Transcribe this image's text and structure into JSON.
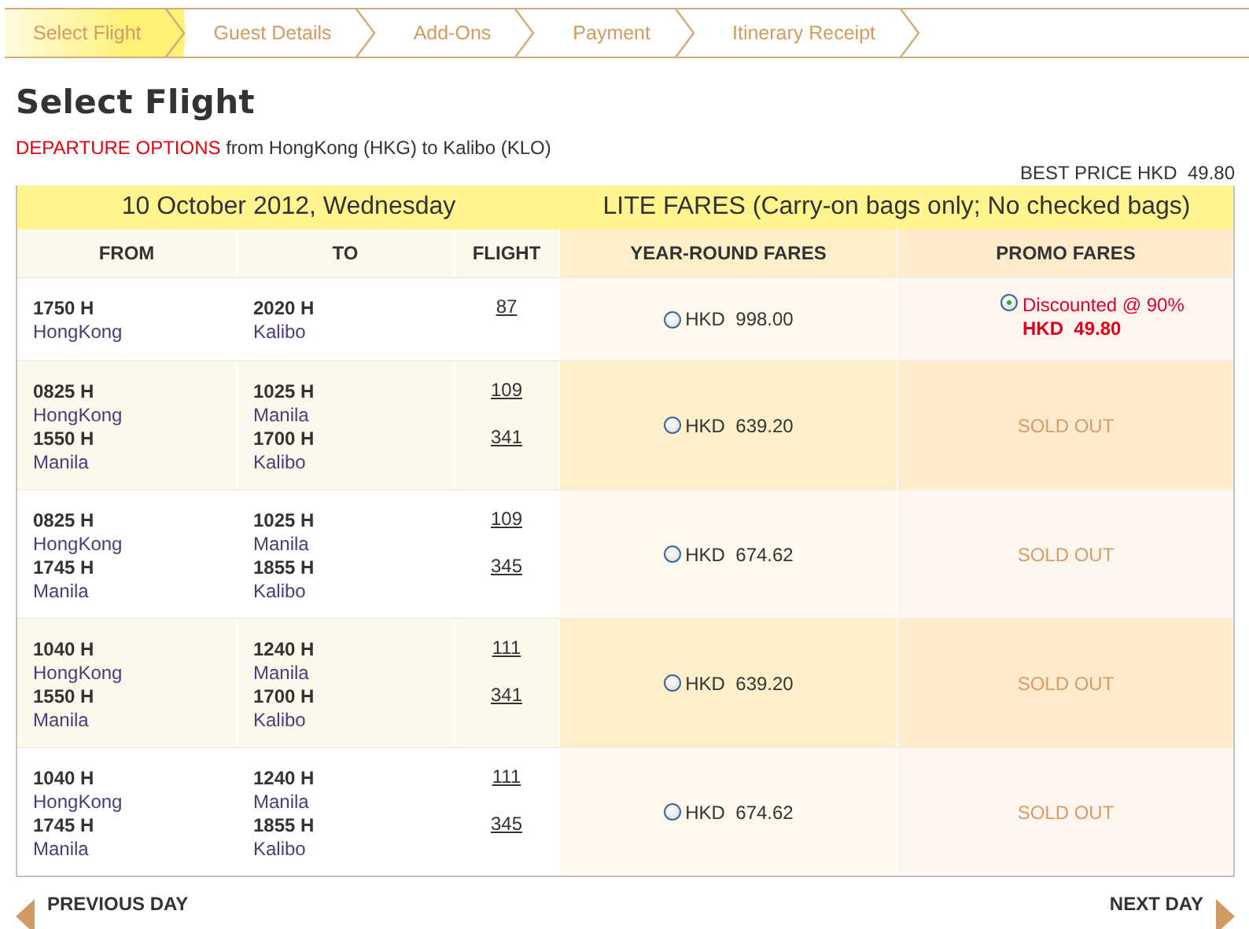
{
  "steps": [
    {
      "label": "Select Flight",
      "selected": true
    },
    {
      "label": "Guest Details",
      "selected": false
    },
    {
      "label": "Add-Ons",
      "selected": false
    },
    {
      "label": "Payment",
      "selected": false
    },
    {
      "label": "Itinerary Receipt",
      "selected": false
    }
  ],
  "title": "Select Flight",
  "route": {
    "label": "DEPARTURE OPTIONS",
    "text": "from HongKong (HKG) to Kalibo (KLO)"
  },
  "best_price": "BEST PRICE HKD  49.80",
  "date": "10 October 2012, Wednesday",
  "fare_title": "LITE FARES (Carry-on bags only; No checked bags)",
  "columns": [
    "FROM",
    "TO",
    "FLIGHT",
    "YEAR-ROUND FARES",
    "PROMO FARES"
  ],
  "flights": [
    {
      "legs": [
        {
          "dep_time": "1750 H",
          "dep_city": "HongKong",
          "arr_time": "2020 H",
          "arr_city": "Kalibo",
          "flight": "87"
        }
      ],
      "year_round": {
        "price": "HKD  998.00",
        "selected": false
      },
      "promo": {
        "kind": "fare",
        "label": "Discounted @ 90%",
        "price": "HKD  49.80",
        "selected": true
      }
    },
    {
      "legs": [
        {
          "dep_time": "0825 H",
          "dep_city": "HongKong",
          "arr_time": "1025 H",
          "arr_city": "Manila",
          "flight": "109"
        },
        {
          "dep_time": "1550 H",
          "dep_city": "Manila",
          "arr_time": "1700 H",
          "arr_city": "Kalibo",
          "flight": "341"
        }
      ],
      "year_round": {
        "price": "HKD  639.20",
        "selected": false
      },
      "promo": {
        "kind": "sold_out",
        "label": "SOLD OUT"
      }
    },
    {
      "legs": [
        {
          "dep_time": "0825 H",
          "dep_city": "HongKong",
          "arr_time": "1025 H",
          "arr_city": "Manila",
          "flight": "109"
        },
        {
          "dep_time": "1745 H",
          "dep_city": "Manila",
          "arr_time": "1855 H",
          "arr_city": "Kalibo",
          "flight": "345"
        }
      ],
      "year_round": {
        "price": "HKD  674.62",
        "selected": false
      },
      "promo": {
        "kind": "sold_out",
        "label": "SOLD OUT"
      }
    },
    {
      "legs": [
        {
          "dep_time": "1040 H",
          "dep_city": "HongKong",
          "arr_time": "1240 H",
          "arr_city": "Manila",
          "flight": "111"
        },
        {
          "dep_time": "1550 H",
          "dep_city": "Manila",
          "arr_time": "1700 H",
          "arr_city": "Kalibo",
          "flight": "341"
        }
      ],
      "year_round": {
        "price": "HKD  639.20",
        "selected": false
      },
      "promo": {
        "kind": "sold_out",
        "label": "SOLD OUT"
      }
    },
    {
      "legs": [
        {
          "dep_time": "1040 H",
          "dep_city": "HongKong",
          "arr_time": "1240 H",
          "arr_city": "Manila",
          "flight": "111"
        },
        {
          "dep_time": "1745 H",
          "dep_city": "Manila",
          "arr_time": "1855 H",
          "arr_city": "Kalibo",
          "flight": "345"
        }
      ],
      "year_round": {
        "price": "HKD  674.62",
        "selected": false
      },
      "promo": {
        "kind": "sold_out",
        "label": "SOLD OUT"
      }
    }
  ],
  "nav": {
    "previous": "PREVIOUS DAY",
    "next": "NEXT DAY"
  }
}
